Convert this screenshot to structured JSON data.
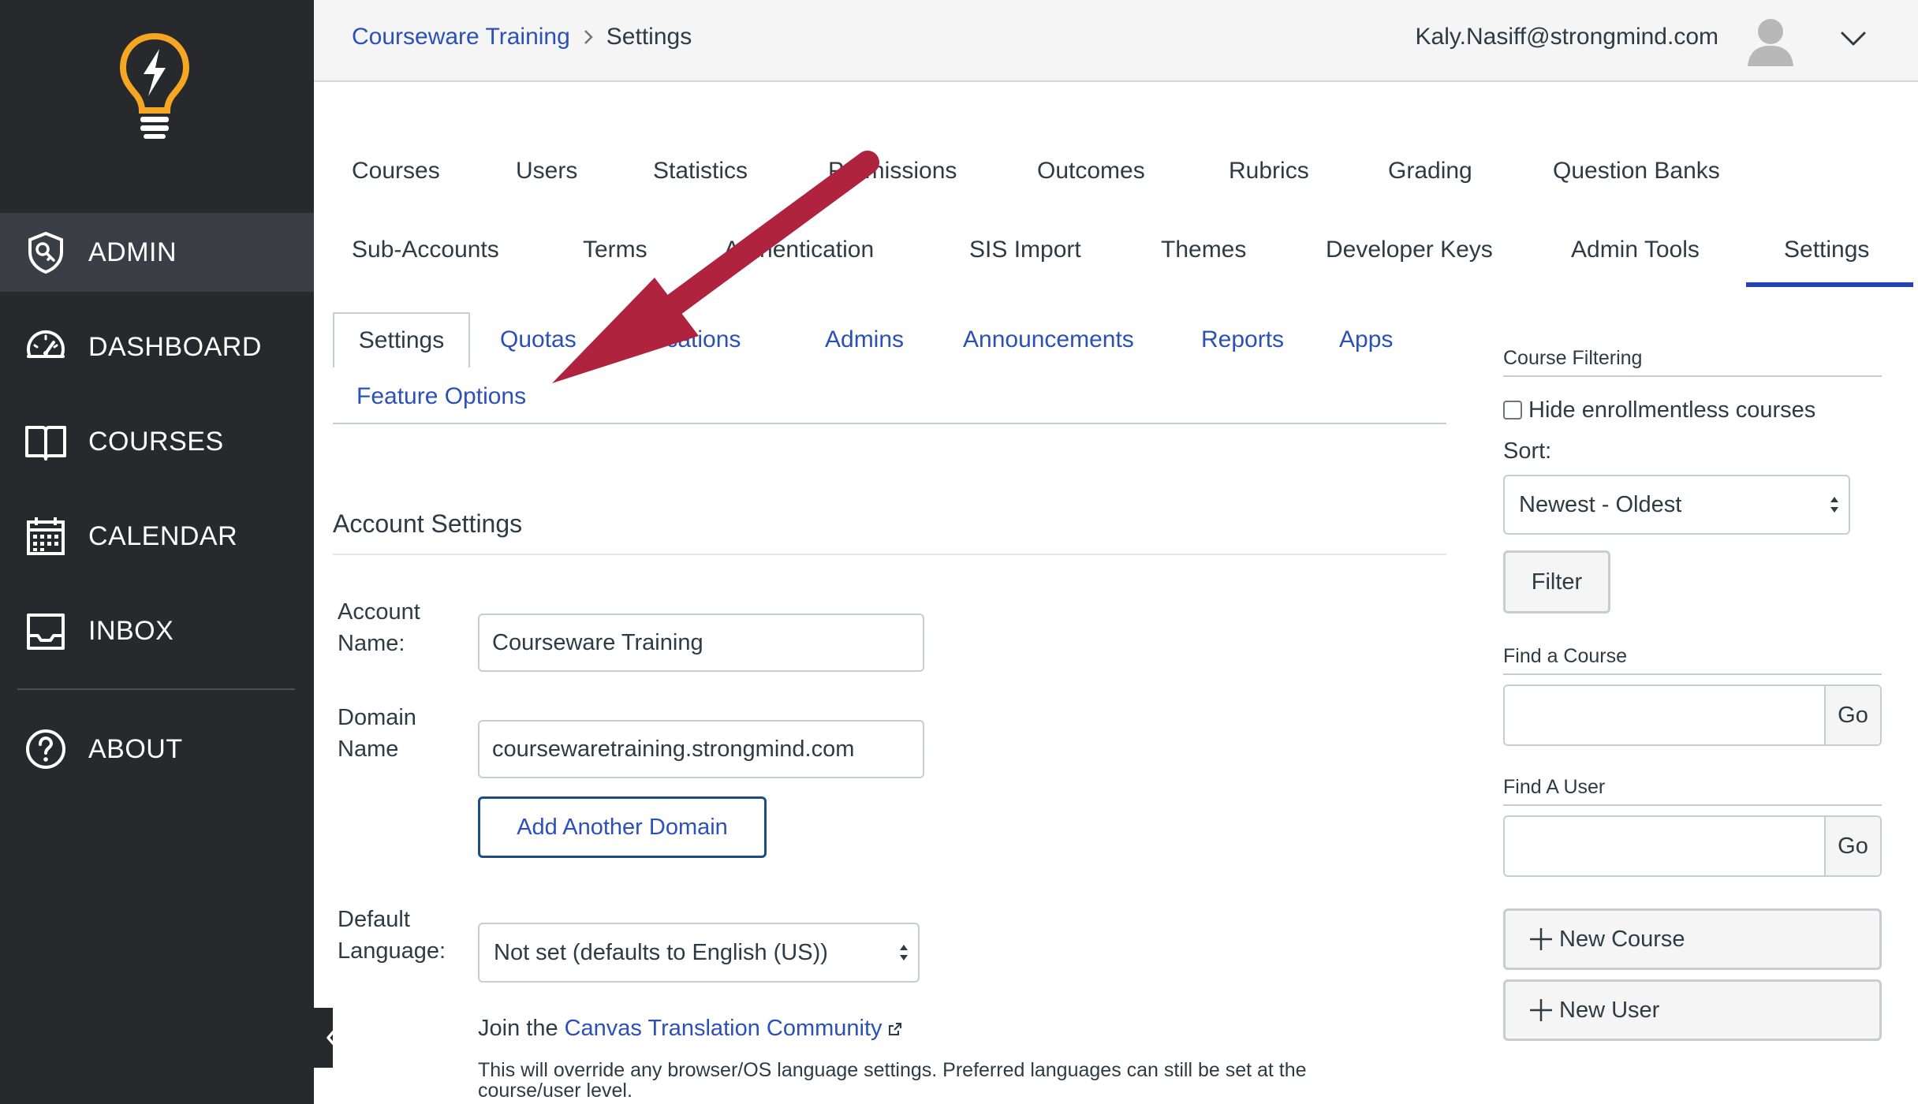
{
  "app": {
    "accent_color": "#2b51b8",
    "sidebar_color": "#27292d"
  },
  "sidebar": {
    "items": [
      {
        "label": "ADMIN",
        "icon": "shield-icon",
        "active": true
      },
      {
        "label": "DASHBOARD",
        "icon": "speedometer-icon"
      },
      {
        "label": "COURSES",
        "icon": "book-icon"
      },
      {
        "label": "CALENDAR",
        "icon": "calendar-icon"
      },
      {
        "label": "INBOX",
        "icon": "inbox-icon"
      },
      {
        "label": "ABOUT",
        "icon": "question-circle-icon"
      }
    ],
    "logo_icon": "lightbulb-bolt-icon",
    "collapse_icon": "chevron-left-icon"
  },
  "header": {
    "breadcrumb": {
      "parent": "Courseware Training",
      "current": "Settings"
    },
    "user_email": "Kaly.Nasiff@strongmind.com",
    "avatar_icon": "user-avatar-icon",
    "menu_icon": "chevron-down-icon"
  },
  "admin_tabs": {
    "row1": [
      "Courses",
      "Users",
      "Statistics",
      "Permissions",
      "Outcomes",
      "Rubrics",
      "Grading",
      "Question Banks"
    ],
    "row2": [
      "Sub-Accounts",
      "Terms",
      "Authentication",
      "SIS Import",
      "Themes",
      "Developer Keys",
      "Admin Tools",
      "Settings"
    ],
    "active": "Settings"
  },
  "sub_tabs": {
    "items": [
      "Settings",
      "Quotas",
      "Notifications",
      "Admins",
      "Announcements",
      "Reports",
      "Apps",
      "Feature Options"
    ],
    "active": "Settings"
  },
  "account_settings": {
    "title": "Account Settings",
    "account_name_label": "Account Name:",
    "account_name_value": "Courseware Training",
    "domain_name_label": "Domain Name",
    "domain_name_value": "coursewaretraining.strongmind.com",
    "add_domain_button": "Add Another Domain",
    "default_language_label": "Default Language:",
    "default_language_value": "Not set (defaults to English (US))",
    "join_prefix": "Join the",
    "join_link": "Canvas Translation Community",
    "help_text": "This will override any browser/OS language settings. Preferred languages can still be set at the course/user level."
  },
  "right_panel": {
    "course_filtering_heading": "Course Filtering",
    "hide_enrollmentless_label": "Hide enrollmentless courses",
    "hide_enrollmentless_checked": false,
    "sort_label": "Sort:",
    "sort_value": "Newest - Oldest",
    "filter_button": "Filter",
    "find_course_heading": "Find a Course",
    "find_course_value": "",
    "find_user_heading": "Find A User",
    "find_user_value": "",
    "go_label": "Go",
    "new_course_button": "New Course",
    "new_user_button": "New User"
  },
  "annotation": {
    "arrow_color": "#b0233f",
    "points_to": "Feature Options"
  }
}
